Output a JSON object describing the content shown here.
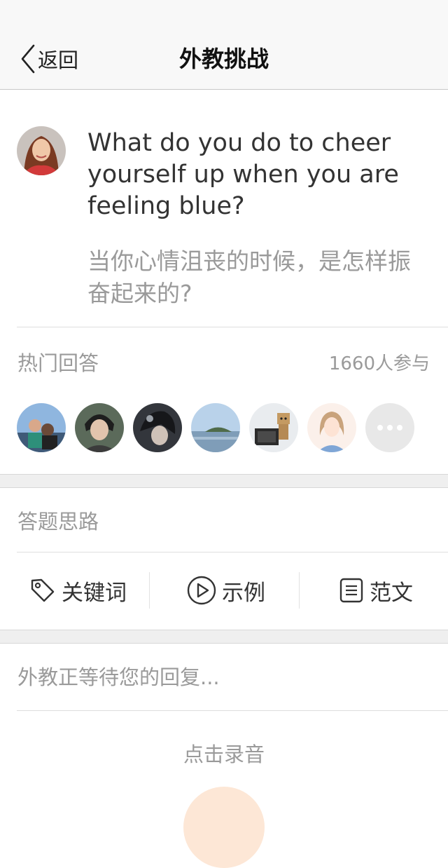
{
  "nav": {
    "back_label": "返回",
    "title": "外教挑战"
  },
  "question": {
    "english": "What do you do to cheer yourself up when you are feeling blue?",
    "chinese": "当你心情沮丧的时候，是怎样振奋起来的?"
  },
  "hot_answers": {
    "title": "热门回答",
    "count": "1660人参与"
  },
  "ideas": {
    "title": "答题思路",
    "tools": [
      {
        "label": "关键词",
        "icon": "tag-icon"
      },
      {
        "label": "示例",
        "icon": "play-icon"
      },
      {
        "label": "范文",
        "icon": "document-icon"
      }
    ]
  },
  "reply": {
    "placeholder": "外教正等待您的回复..."
  },
  "record": {
    "label": "点击录音"
  },
  "colors": {
    "accent": "#fde7d6",
    "muted_text": "#9a9a9a",
    "divider": "#dedede"
  }
}
